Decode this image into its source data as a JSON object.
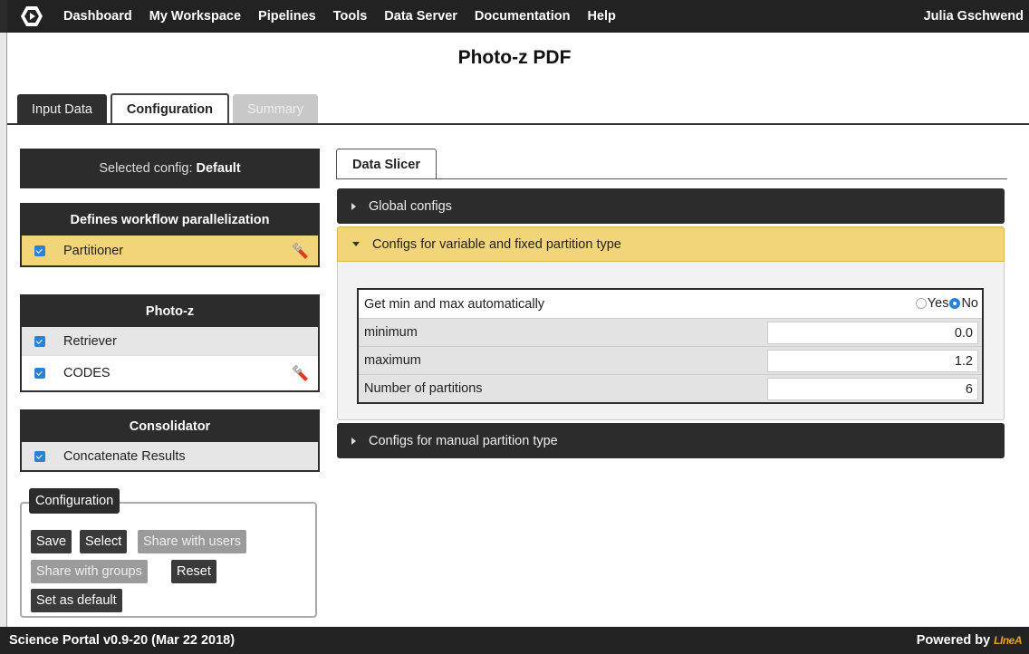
{
  "nav": {
    "logo_icon": "linea-hex-logo",
    "items": [
      "Dashboard",
      "My Workspace",
      "Pipelines",
      "Tools",
      "Data Server",
      "Documentation",
      "Help"
    ],
    "user": "Julia Gschwend"
  },
  "page": {
    "title": "Photo-z PDF"
  },
  "tabs": [
    {
      "label": "Input Data",
      "state": "inactive"
    },
    {
      "label": "Configuration",
      "state": "active"
    },
    {
      "label": "Summary",
      "state": "disabled"
    }
  ],
  "left": {
    "selected_config_prefix": "Selected config:",
    "selected_config_value": "Default",
    "panels": [
      {
        "title": "Defines workflow parallelization",
        "rows": [
          {
            "label": "Partitioner",
            "checked": true,
            "wrench": true,
            "highlight": true
          }
        ]
      },
      {
        "title": "Photo-z",
        "rows": [
          {
            "label": "Retriever",
            "checked": true,
            "wrench": false
          },
          {
            "label": "CODES",
            "checked": true,
            "wrench": true
          }
        ]
      },
      {
        "title": "Consolidator",
        "rows": [
          {
            "label": "Concatenate Results",
            "checked": true,
            "wrench": false
          }
        ]
      }
    ],
    "config_box": {
      "legend": "Configuration",
      "save": "Save",
      "select": "Select",
      "share_users": "Share with users",
      "share_groups": "Share with groups",
      "reset": "Reset",
      "set_default": "Set as default"
    }
  },
  "right": {
    "inner_tab": "Data Slicer",
    "accordions": {
      "global": "Global configs",
      "variable": "Configs for variable and fixed partition type",
      "manual": "Configs for manual partition type"
    },
    "fields": {
      "auto_label": "Get min and max automatically",
      "yes": "Yes",
      "no": "No",
      "auto_selected": "No",
      "min_label": "minimum",
      "min_value": "0.0",
      "max_label": "maximum",
      "max_value": "1.2",
      "parts_label": "Number of partitions",
      "parts_value": "6"
    }
  },
  "footer": {
    "version": "Science Portal v0.9-20 (Mar 22 2018)",
    "powered": "Powered by",
    "brand": "LIneA"
  },
  "colors": {
    "highlight": "#f2d579",
    "dark": "#2c2c2c",
    "checkbox": "#2a82d6",
    "brand": "#f0a020"
  }
}
